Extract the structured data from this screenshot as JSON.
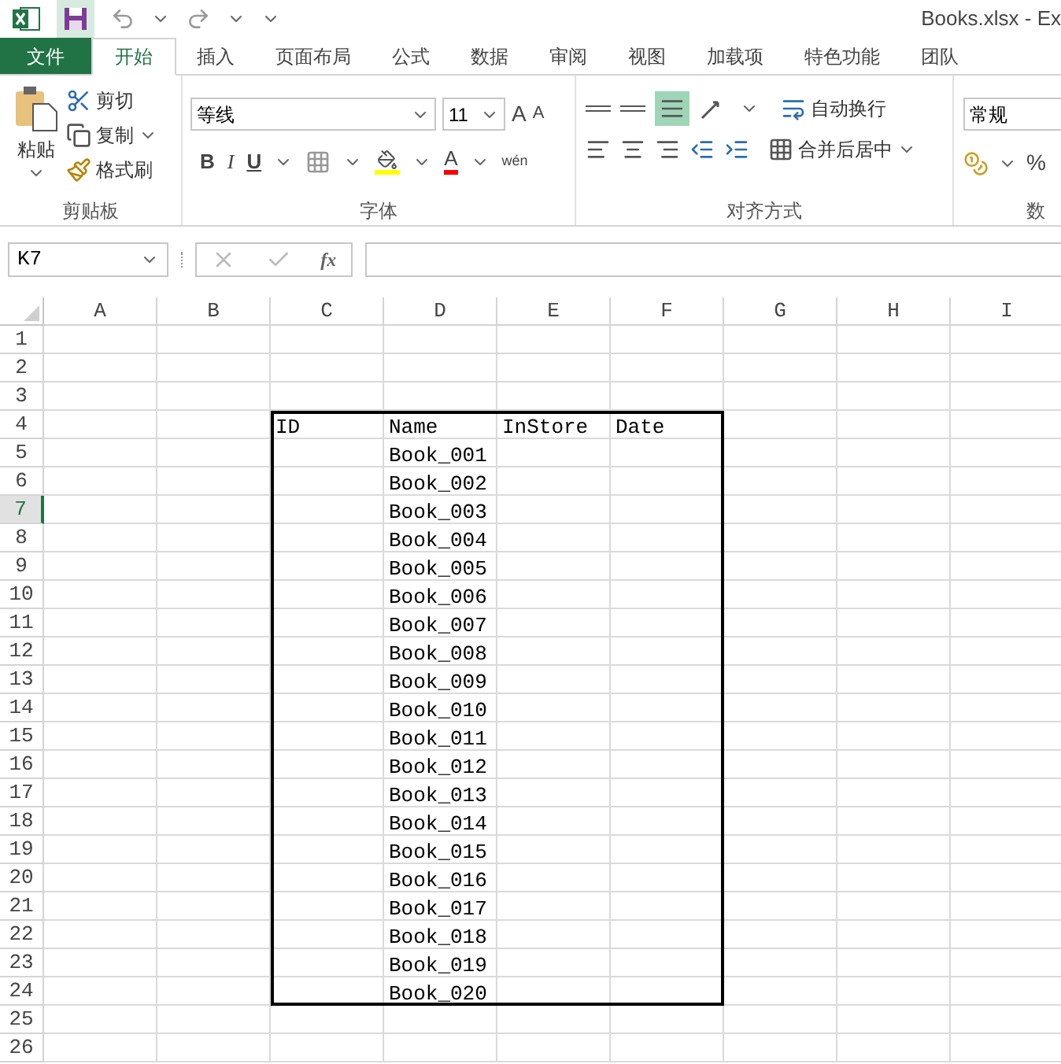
{
  "title_bar": {
    "title": "Books.xlsx - Ex"
  },
  "tabs": [
    {
      "label": "文件",
      "kind": "file",
      "selected": false
    },
    {
      "label": "开始",
      "kind": "tab",
      "selected": true
    },
    {
      "label": "插入",
      "kind": "tab",
      "selected": false
    },
    {
      "label": "页面布局",
      "kind": "tab",
      "selected": false
    },
    {
      "label": "公式",
      "kind": "tab",
      "selected": false
    },
    {
      "label": "数据",
      "kind": "tab",
      "selected": false
    },
    {
      "label": "审阅",
      "kind": "tab",
      "selected": false
    },
    {
      "label": "视图",
      "kind": "tab",
      "selected": false
    },
    {
      "label": "加载项",
      "kind": "tab",
      "selected": false
    },
    {
      "label": "特色功能",
      "kind": "tab",
      "selected": false
    },
    {
      "label": "团队",
      "kind": "tab",
      "selected": false
    }
  ],
  "ribbon": {
    "clipboard": {
      "paste": "粘贴",
      "cut": "剪切",
      "copy": "复制",
      "format_painter": "格式刷",
      "group": "剪贴板"
    },
    "font": {
      "name": "等线",
      "size": "11",
      "grow": "A",
      "shrink": "A",
      "bold": "B",
      "italic": "I",
      "underline": "U",
      "font_color": "A",
      "phonetic": "wén",
      "group": "字体"
    },
    "alignment": {
      "bottom_align_selected": true,
      "wrap_text": "自动换行",
      "merge_center": "合并后居中",
      "group": "对齐方式"
    },
    "number": {
      "format": "常规",
      "percent": "%",
      "group": "数"
    }
  },
  "formula_bar": {
    "name_box": "K7",
    "fx": "fx"
  },
  "sheet": {
    "columns": [
      "A",
      "B",
      "C",
      "D",
      "E",
      "F",
      "G",
      "H",
      "I"
    ],
    "rows": [
      {
        "label": "1",
        "selected": false
      },
      {
        "label": "2",
        "selected": false
      },
      {
        "label": "3",
        "selected": false
      },
      {
        "label": "4",
        "selected": false
      },
      {
        "label": "5",
        "selected": false
      },
      {
        "label": "6",
        "selected": false
      },
      {
        "label": "7",
        "selected": true
      },
      {
        "label": "8",
        "selected": false
      },
      {
        "label": "9",
        "selected": false
      },
      {
        "label": "10",
        "selected": false
      },
      {
        "label": "11",
        "selected": false
      },
      {
        "label": "12",
        "selected": false
      },
      {
        "label": "13",
        "selected": false
      },
      {
        "label": "14",
        "selected": false
      },
      {
        "label": "15",
        "selected": false
      },
      {
        "label": "16",
        "selected": false
      },
      {
        "label": "17",
        "selected": false
      },
      {
        "label": "18",
        "selected": false
      },
      {
        "label": "19",
        "selected": false
      },
      {
        "label": "20",
        "selected": false
      },
      {
        "label": "21",
        "selected": false
      },
      {
        "label": "22",
        "selected": false
      },
      {
        "label": "23",
        "selected": false
      },
      {
        "label": "24",
        "selected": false
      },
      {
        "label": "25",
        "selected": false
      },
      {
        "label": "26",
        "selected": false
      }
    ],
    "table": {
      "header": [
        "ID",
        "Name",
        "InStore",
        "Date"
      ],
      "rows": [
        {
          "name": "Book_001"
        },
        {
          "name": "Book_002"
        },
        {
          "name": "Book_003"
        },
        {
          "name": "Book_004"
        },
        {
          "name": "Book_005"
        },
        {
          "name": "Book_006"
        },
        {
          "name": "Book_007"
        },
        {
          "name": "Book_008"
        },
        {
          "name": "Book_009"
        },
        {
          "name": "Book_010"
        },
        {
          "name": "Book_011"
        },
        {
          "name": "Book_012"
        },
        {
          "name": "Book_013"
        },
        {
          "name": "Book_014"
        },
        {
          "name": "Book_015"
        },
        {
          "name": "Book_016"
        },
        {
          "name": "Book_017"
        },
        {
          "name": "Book_018"
        },
        {
          "name": "Book_019"
        },
        {
          "name": "Book_020"
        }
      ]
    }
  }
}
